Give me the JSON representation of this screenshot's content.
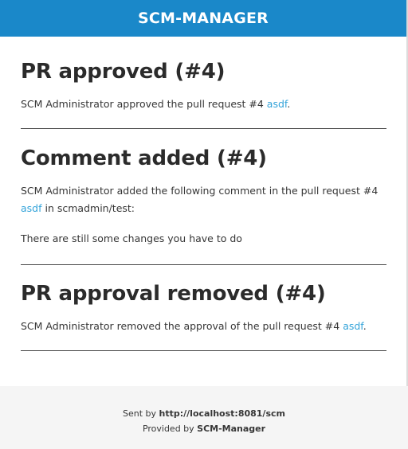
{
  "header": {
    "title": "SCM-MANAGER"
  },
  "sections": [
    {
      "title": "PR approved (#4)",
      "text_before": "SCM Administrator approved the pull request #4 ",
      "link": "asdf",
      "text_after": "."
    },
    {
      "title": "Comment added (#4)",
      "text_before": "SCM Administrator added the following comment in the pull request #4 ",
      "link": "asdf",
      "text_after": " in scmadmin/test:",
      "comment": "There are still some changes you have to do"
    },
    {
      "title": "PR approval removed (#4)",
      "text_before": "SCM Administrator removed the approval of the pull request #4 ",
      "link": "asdf",
      "text_after": "."
    }
  ],
  "footer": {
    "sent_by_prefix": "Sent by ",
    "sent_by_url": "http://localhost:8081/scm",
    "provided_by_prefix": "Provided by ",
    "provided_by_name": "SCM-Manager"
  },
  "colors": {
    "header_bg": "#1a88c9",
    "link": "#33a3d9",
    "footer_bg": "#f5f5f5"
  }
}
